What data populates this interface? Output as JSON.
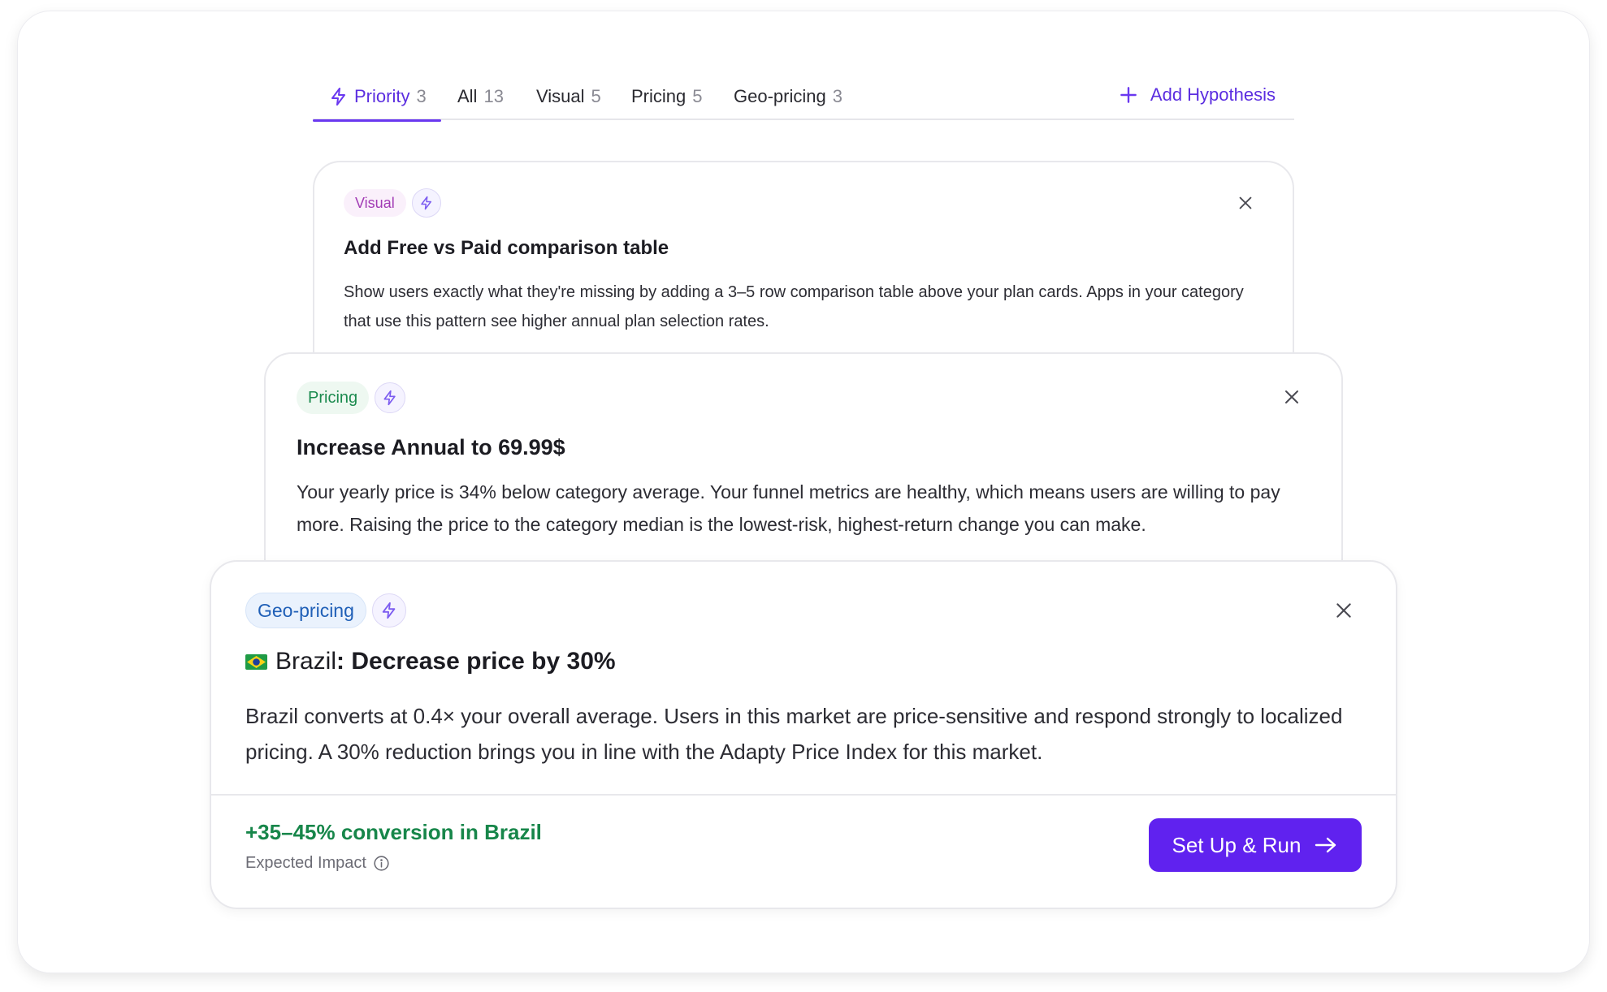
{
  "tabs": [
    {
      "label": "Priority",
      "count": "3",
      "active": true
    },
    {
      "label": "All",
      "count": "13"
    },
    {
      "label": "Visual",
      "count": "5"
    },
    {
      "label": "Pricing",
      "count": "5"
    },
    {
      "label": "Geo-pricing",
      "count": "3"
    }
  ],
  "add_hypothesis": "Add Hypothesis",
  "cards": [
    {
      "tag": "Visual",
      "title": "Add Free vs Paid comparison table",
      "description": "Show users exactly what they're missing by adding a 3–5 row comparison table above your plan cards. Apps in your category that use this pattern see higher annual plan selection rates."
    },
    {
      "tag": "Pricing",
      "title": "Increase Annual to 69.99$",
      "description": "Your yearly price is 34% below category average. Your funnel metrics are healthy, which means users are willing to pay more. Raising the price to the category median is the lowest-risk, highest-return change you can make."
    },
    {
      "tag": "Geo-pricing",
      "country": "Brazil",
      "title": "Decrease price by 30%",
      "description": "Brazil converts at 0.4× your overall average. Users in this market are price-sensitive and respond strongly to localized pricing. A 30% reduction brings you in line with the Adapty Price Index for this market.",
      "impact": "+35–45% conversion in Brazil",
      "impact_label": "Expected Impact",
      "cta": "Set Up & Run"
    }
  ],
  "colors": {
    "accent": "#6022ef",
    "visual_tag": "#a23cb5",
    "pricing_tag": "#1b8a4e",
    "geo_tag": "#1f5fb7",
    "impact": "#17864a"
  }
}
